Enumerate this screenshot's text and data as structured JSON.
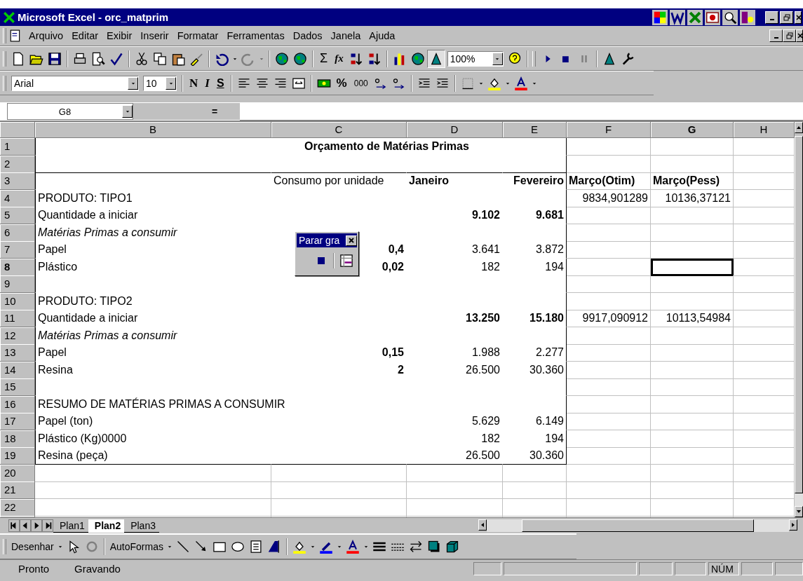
{
  "window": {
    "title": "Microsoft Excel - orc_matprim"
  },
  "menu": [
    "Arquivo",
    "Editar",
    "Exibir",
    "Inserir",
    "Formatar",
    "Ferramentas",
    "Dados",
    "Janela",
    "Ajuda"
  ],
  "standard_toolbar": {
    "sum": "Σ",
    "function": "fx",
    "zoom": "100%"
  },
  "formatting_toolbar": {
    "font": "Arial",
    "size": "10",
    "bold": "N",
    "italic": "I",
    "underline": "S",
    "percent": "%",
    "thousands": "000"
  },
  "formula_bar": {
    "name_box": "G8",
    "equals": "="
  },
  "sheet": {
    "columns": [
      {
        "label": "B",
        "selected": false
      },
      {
        "label": "C",
        "selected": false
      },
      {
        "label": "D",
        "selected": false
      },
      {
        "label": "E",
        "selected": false
      },
      {
        "label": "F",
        "selected": false
      },
      {
        "label": "G",
        "selected": true
      },
      {
        "label": "H",
        "selected": false
      }
    ],
    "rows": [
      {
        "number": "1",
        "selected": false,
        "cells": {
          "C": {
            "text": "Orçamento de Matérias Primas",
            "kind": "title"
          }
        }
      },
      {
        "number": "2",
        "selected": false,
        "cells": {}
      },
      {
        "number": "3",
        "selected": false,
        "cells": {
          "C": {
            "text": "Consumo por unidade",
            "kind": "label"
          },
          "D": {
            "text": "Janeiro",
            "kind": "label-bold"
          },
          "E": {
            "text": "Fevereiro",
            "kind": "label-bold-right"
          },
          "F": {
            "text": "Março(Otim)",
            "kind": "label-bold"
          },
          "G": {
            "text": "Março(Pess)",
            "kind": "label-bold"
          }
        }
      },
      {
        "number": "4",
        "selected": false,
        "cells": {
          "B": {
            "text": "PRODUTO: TIPO1",
            "kind": "label"
          },
          "F": {
            "text": "9834,901289",
            "kind": "number"
          },
          "G": {
            "text": "10136,37121",
            "kind": "number"
          }
        }
      },
      {
        "number": "5",
        "selected": false,
        "cells": {
          "B": {
            "text": "Quantidade a iniciar",
            "kind": "label"
          },
          "D": {
            "text": "9.102",
            "kind": "number-bold"
          },
          "E": {
            "text": "9.681",
            "kind": "number-bold"
          }
        }
      },
      {
        "number": "6",
        "selected": false,
        "cells": {
          "B": {
            "text": "Matérias Primas a consumir",
            "kind": "label-italic"
          }
        }
      },
      {
        "number": "7",
        "selected": false,
        "cells": {
          "B": {
            "text": "Papel",
            "kind": "label"
          },
          "C": {
            "text": "0,4",
            "kind": "number-bold"
          },
          "D": {
            "text": "3.641",
            "kind": "number"
          },
          "E": {
            "text": "3.872",
            "kind": "number"
          }
        }
      },
      {
        "number": "8",
        "selected": true,
        "cells": {
          "B": {
            "text": "Plástico",
            "kind": "label"
          },
          "C": {
            "text": "0,02",
            "kind": "number-bold"
          },
          "D": {
            "text": "182",
            "kind": "number"
          },
          "E": {
            "text": "194",
            "kind": "number"
          }
        }
      },
      {
        "number": "9",
        "selected": false,
        "cells": {}
      },
      {
        "number": "10",
        "selected": false,
        "cells": {
          "B": {
            "text": "PRODUTO: TIPO2",
            "kind": "label"
          }
        }
      },
      {
        "number": "11",
        "selected": false,
        "cells": {
          "B": {
            "text": "Quantidade a iniciar",
            "kind": "label"
          },
          "D": {
            "text": "13.250",
            "kind": "number-bold"
          },
          "E": {
            "text": "15.180",
            "kind": "number-bold"
          },
          "F": {
            "text": "9917,090912",
            "kind": "number"
          },
          "G": {
            "text": "10113,54984",
            "kind": "number"
          }
        }
      },
      {
        "number": "12",
        "selected": false,
        "cells": {
          "B": {
            "text": "Matérias Primas a consumir",
            "kind": "label-italic"
          }
        }
      },
      {
        "number": "13",
        "selected": false,
        "cells": {
          "B": {
            "text": "Papel",
            "kind": "label"
          },
          "C": {
            "text": "0,15",
            "kind": "number-bold"
          },
          "D": {
            "text": "1.988",
            "kind": "number"
          },
          "E": {
            "text": "2.277",
            "kind": "number"
          }
        }
      },
      {
        "number": "14",
        "selected": false,
        "cells": {
          "B": {
            "text": "Resina",
            "kind": "label"
          },
          "C": {
            "text": "2",
            "kind": "number-bold"
          },
          "D": {
            "text": "26.500",
            "kind": "number"
          },
          "E": {
            "text": "30.360",
            "kind": "number"
          }
        }
      },
      {
        "number": "15",
        "selected": false,
        "cells": {}
      },
      {
        "number": "16",
        "selected": false,
        "cells": {
          "B": {
            "text": "RESUMO DE MATÉRIAS PRIMAS A CONSUMIR",
            "kind": "label"
          }
        }
      },
      {
        "number": "17",
        "selected": false,
        "cells": {
          "B": {
            "text": "Papel (ton)",
            "kind": "label"
          },
          "D": {
            "text": "5.629",
            "kind": "number"
          },
          "E": {
            "text": "6.149",
            "kind": "number"
          }
        }
      },
      {
        "number": "18",
        "selected": false,
        "cells": {
          "B": {
            "text": "Plástico (Kg)0000",
            "kind": "label"
          },
          "D": {
            "text": "182",
            "kind": "number"
          },
          "E": {
            "text": "194",
            "kind": "number"
          }
        }
      },
      {
        "number": "19",
        "selected": false,
        "cells": {
          "B": {
            "text": "Resina (peça)",
            "kind": "label"
          },
          "D": {
            "text": "26.500",
            "kind": "number"
          },
          "E": {
            "text": "30.360",
            "kind": "number"
          }
        }
      },
      {
        "number": "20",
        "selected": false,
        "cells": {}
      },
      {
        "number": "21",
        "selected": false,
        "cells": {}
      },
      {
        "number": "22",
        "selected": false,
        "cells": {}
      }
    ]
  },
  "floating_toolbar": {
    "title": "Parar gra"
  },
  "sheet_tabs": [
    {
      "label": "Plan1",
      "selected": false
    },
    {
      "label": "Plan2",
      "selected": true
    },
    {
      "label": "Plan3",
      "selected": false
    }
  ],
  "drawing_toolbar": {
    "draw": "Desenhar",
    "autoshapes": "AutoFormas"
  },
  "status_bar": {
    "message": "Pronto",
    "recording": "Gravando",
    "num_lock": "NÚM"
  }
}
